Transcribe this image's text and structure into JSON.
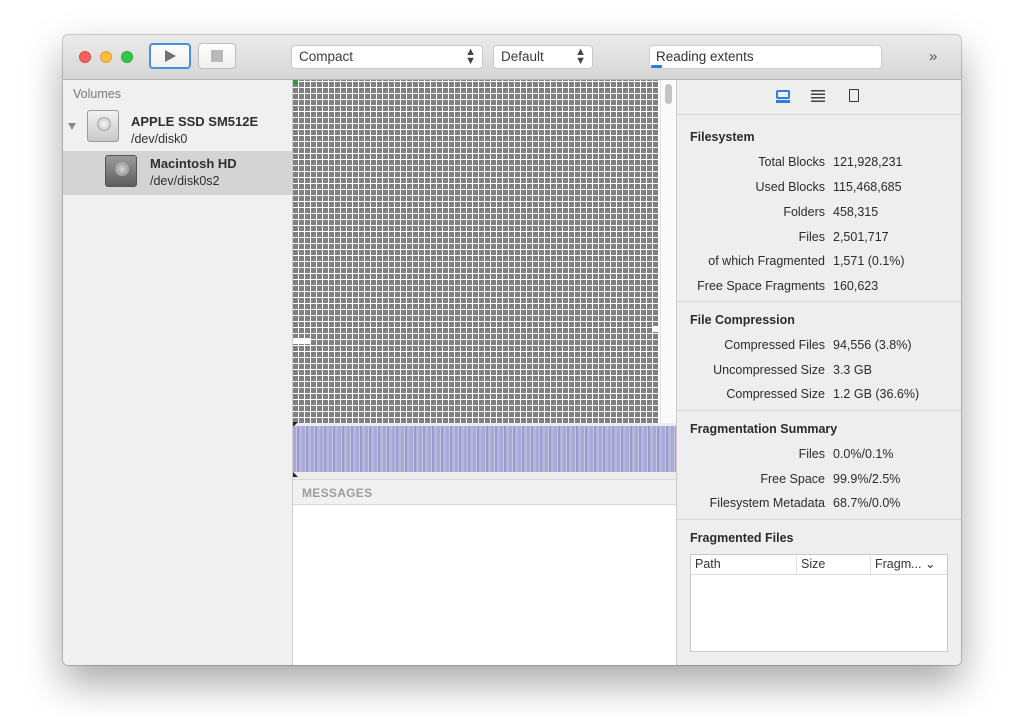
{
  "toolbar": {
    "view_mode": "Compact",
    "color_scheme": "Default",
    "status_text": "Reading extents",
    "progress": 0.05,
    "overflow_glyph": "»"
  },
  "sidebar": {
    "header": "Volumes",
    "disk": {
      "name": "APPLE SSD SM512E",
      "path": "/dev/disk0"
    },
    "volume": {
      "name": "Macintosh HD",
      "path": "/dev/disk0s2"
    }
  },
  "messages": {
    "title": "MESSAGES"
  },
  "inspector": {
    "filesystem": {
      "title": "Filesystem",
      "rows": [
        {
          "label": "Total Blocks",
          "value": "121,928,231"
        },
        {
          "label": "Used Blocks",
          "value": "115,468,685"
        },
        {
          "label": "Folders",
          "value": "458,315"
        },
        {
          "label": "Files",
          "value": "2,501,717"
        },
        {
          "label": "of which Fragmented",
          "value": "1,571 (0.1%)"
        },
        {
          "label": "Free Space Fragments",
          "value": "160,623"
        }
      ]
    },
    "compression": {
      "title": "File Compression",
      "rows": [
        {
          "label": "Compressed Files",
          "value": "94,556 (3.8%)"
        },
        {
          "label": "Uncompressed Size",
          "value": "3.3 GB"
        },
        {
          "label": "Compressed Size",
          "value": "1.2 GB (36.6%)"
        }
      ]
    },
    "fragmentation": {
      "title": "Fragmentation Summary",
      "rows": [
        {
          "label": "Files",
          "value": "0.0%/0.1%"
        },
        {
          "label": "Free Space",
          "value": "99.9%/2.5%"
        },
        {
          "label": "Filesystem Metadata",
          "value": "68.7%/0.0%"
        }
      ]
    },
    "fragmented_files": {
      "title": "Fragmented Files",
      "columns": [
        "Path",
        "Size",
        "Fragm... ⌄"
      ]
    }
  },
  "colors": {
    "accent": "#2f7fd8",
    "block_used": "#808080",
    "block_green": "#2f9d3b",
    "strip": "#a9a9d6"
  }
}
